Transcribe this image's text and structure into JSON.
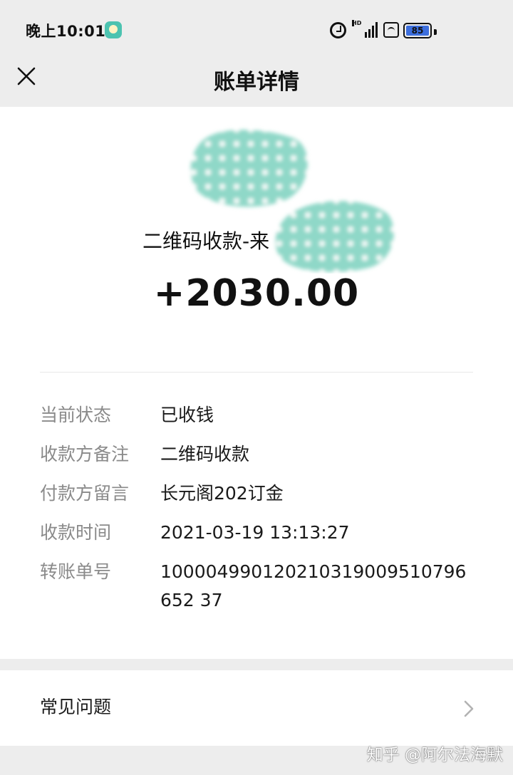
{
  "status_bar": {
    "time": "晚上10:01",
    "signal_label": "HD",
    "battery_level": "85"
  },
  "nav": {
    "title": "账单详情",
    "close_icon": "close-icon"
  },
  "transaction": {
    "merchant": "二维码收款-来",
    "amount": "+2030.00"
  },
  "details": [
    {
      "label": "当前状态",
      "value": "已收钱"
    },
    {
      "label": "收款方备注",
      "value": "二维码收款"
    },
    {
      "label": "付款方留言",
      "value": "长元阁202订金"
    },
    {
      "label": "收款时间",
      "value": "2021-03-19 13:13:27"
    },
    {
      "label": "转账单号",
      "value": "100004990120210319009510796652 37"
    }
  ],
  "faq": {
    "label": "常见问题",
    "icon": "chevron-right-icon"
  },
  "watermark": "知乎 @阿尔法海默",
  "colors": {
    "nav_bg": "#ededed",
    "card_bg": "#ffffff",
    "label_gray": "#8a8a8a",
    "blob_teal": "#8fd8c8",
    "battery_blue": "#3c6edd"
  }
}
